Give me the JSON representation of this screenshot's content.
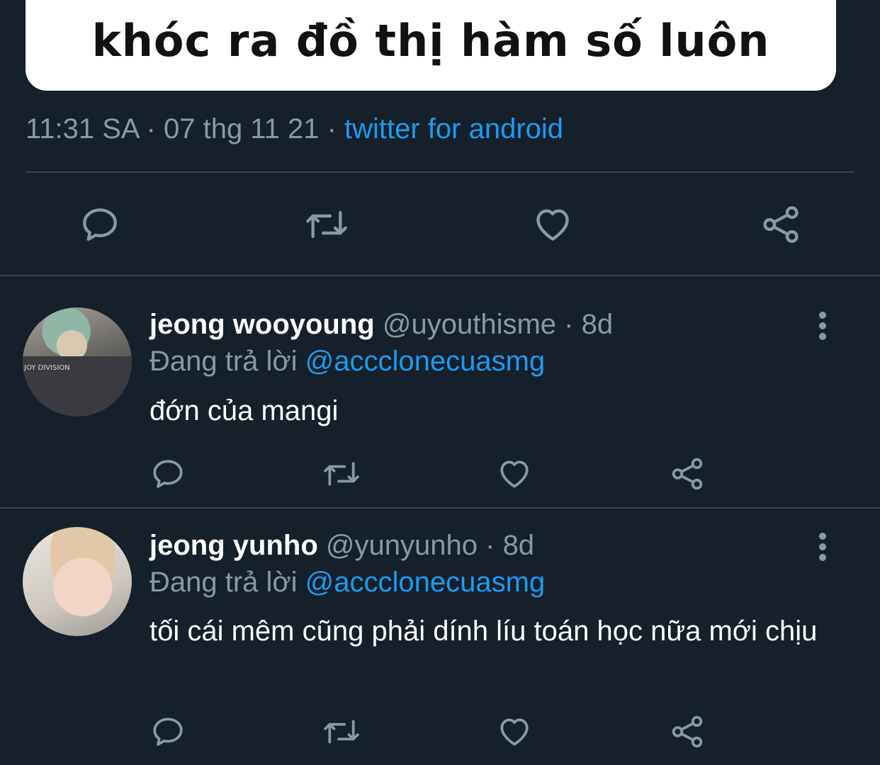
{
  "tweet": {
    "image_caption": "khóc ra đồ thị hàm số luôn",
    "time": "11:31 SA",
    "date": "07 thg 11 21",
    "source": "twitter for android",
    "sep": "·"
  },
  "actions": {
    "icons": [
      "comment-icon",
      "retweet-icon",
      "like-icon",
      "share-icon"
    ]
  },
  "replies": [
    {
      "name": "jeong wooyoung",
      "handle": "@uyouthisme",
      "time": "8d",
      "replying_label": "Đang trả lời",
      "replying_to": "@accclonecuasmg",
      "text": "đớn của mangi",
      "avatar_text": "JOY DIVISION"
    },
    {
      "name": "jeong yunho",
      "handle": "@yunyunho",
      "time": "8d",
      "replying_label": "Đang trả lời",
      "replying_to": "@accclonecuasmg",
      "text": "tối cái mêm cũng phải dính líu toán học nữa mới chịu"
    }
  ],
  "colors": {
    "background": "#15202b",
    "muted": "#8899a6",
    "accent": "#1d9bf0",
    "divider": "#38444d"
  }
}
